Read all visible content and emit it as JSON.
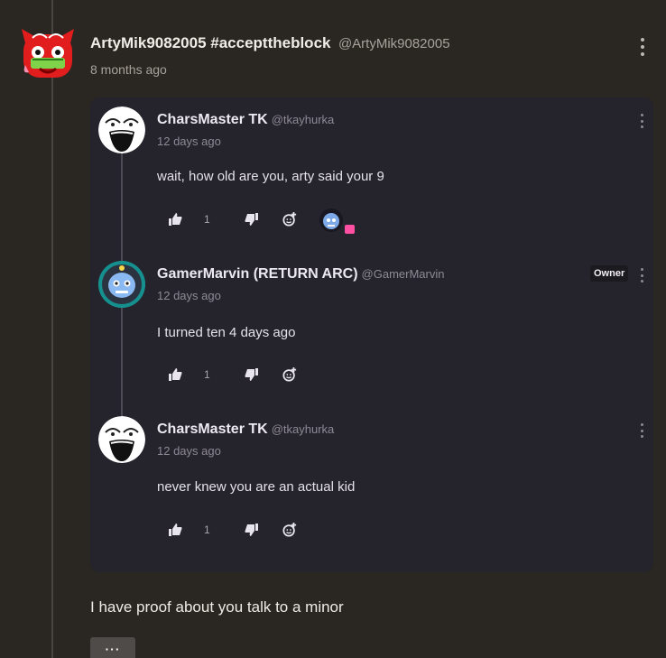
{
  "post": {
    "author_name": "ArtyMik9082005 #accepttheblock",
    "author_handle": "@ArtyMik9082005",
    "time": "8 months ago",
    "body": "I have proof about you talk to a minor",
    "more_label": "···"
  },
  "replies": [
    {
      "name": "CharsMaster TK",
      "handle": "@tkayhurka",
      "time": "12 days ago",
      "text": "wait, how old are you, arty said your 9",
      "likes": "1"
    },
    {
      "name": "GamerMarvin (RETURN ARC)",
      "handle": "@GamerMarvin",
      "time": "12 days ago",
      "text": "I turned ten 4 days ago",
      "likes": "1",
      "badge": "Owner"
    },
    {
      "name": "CharsMaster TK",
      "handle": "@tkayhurka",
      "time": "12 days ago",
      "text": "never knew you are an actual kid",
      "likes": "1"
    }
  ],
  "colors": {
    "background": "#2a2622",
    "reply_panel": "#25232c",
    "reaction_heart": "#ff4fa3",
    "owner_badge_bg": "#1b1a1f"
  }
}
